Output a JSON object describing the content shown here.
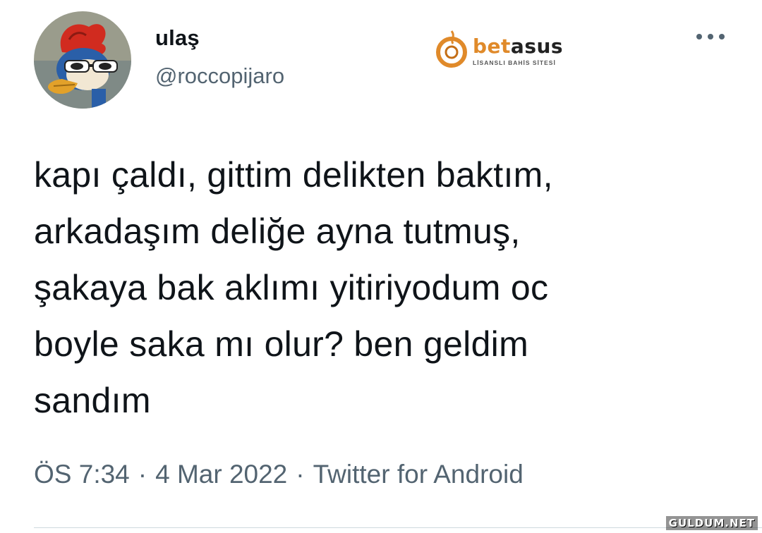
{
  "tweet": {
    "display_name": "ulaş",
    "handle": "@roccopijaro",
    "avatar_icon": "woody-woodpecker-avatar",
    "more_icon": "more-options-icon",
    "text_lines": [
      "kapı çaldı, gittim delikten baktım,",
      "arkadaşım deliğe ayna tutmuş,",
      "şakaya bak aklımı yitiriyodum oc",
      "boyle saka mı olur? ben geldim",
      "sandım"
    ],
    "time": "ÖS 7:34",
    "separator": "·",
    "date": "4 Mar 2022",
    "source": "Twitter for Android"
  },
  "watermark": {
    "brand_part1": "bet",
    "brand_part2": "asus",
    "tagline": "LİSANSLI BAHİS SİTESİ",
    "accent_color": "#e08a2a"
  },
  "site_watermark": "GULDUM.NET",
  "colors": {
    "text": "#0f1419",
    "secondary": "#536471",
    "divider": "#cfd9de"
  }
}
